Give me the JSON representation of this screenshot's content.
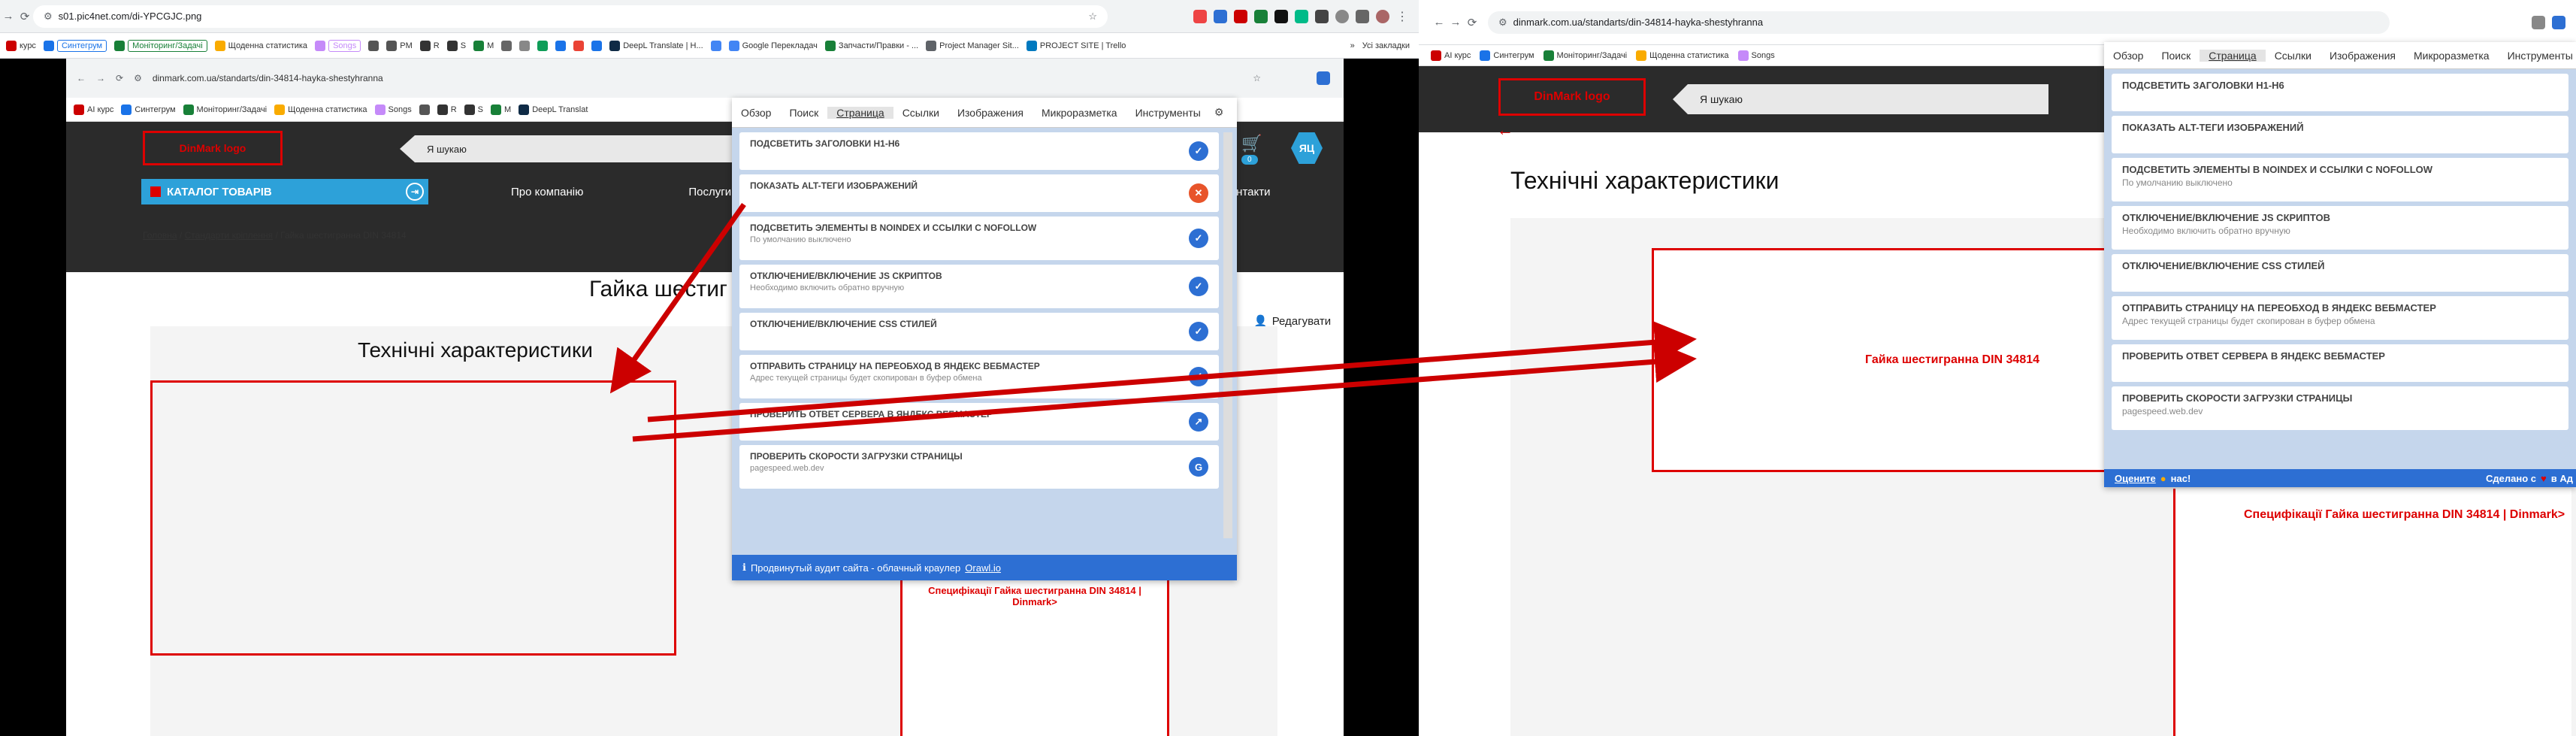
{
  "left_browser": {
    "url": "s01.pic4net.com/di-YPCGJC.png",
    "bookmarks": [
      {
        "label": "курс",
        "color": "#c00"
      },
      {
        "label": "Синтегрум",
        "color": "#1a73e8",
        "tag": true
      },
      {
        "label": "Моніторинг/Задачі",
        "color": "#188038",
        "tag": true
      },
      {
        "label": "Щоденна статистика",
        "color": "#f9ab00"
      },
      {
        "label": "Songs",
        "color": "#c58af9",
        "tag": true
      },
      {
        "label": "",
        "color": "#555"
      },
      {
        "label": "PM",
        "color": "#555"
      },
      {
        "label": "R",
        "color": "#333"
      },
      {
        "label": "S",
        "color": "#333"
      },
      {
        "label": "M",
        "color": "#188038"
      },
      {
        "label": "",
        "color": "#666"
      },
      {
        "label": "",
        "color": "#888"
      },
      {
        "label": "",
        "color": "#0f9d58"
      },
      {
        "label": "",
        "color": "#1a73e8"
      },
      {
        "label": "",
        "color": "#ea4335"
      },
      {
        "label": "",
        "color": "#1a73e8"
      },
      {
        "label": "DeepL Translate | Н...",
        "color": "#0f2b46"
      },
      {
        "label": "",
        "color": "#4285f4"
      },
      {
        "label": "Google Перекладач",
        "color": "#4285f4"
      },
      {
        "label": "Запчасти/Правки - ...",
        "color": "#188038"
      },
      {
        "label": "Project Manager Sit...",
        "color": "#5f6368"
      },
      {
        "label": "PROJECT SITE | Trello",
        "color": "#0079bf"
      }
    ],
    "bookmarks_more": "»",
    "all_bookmarks": "Усі закладки"
  },
  "inner_browser": {
    "url": "dinmark.com.ua/standarts/din-34814-hayka-shestyhranna",
    "bookmarks": [
      {
        "label": "AI курс",
        "color": "#c00"
      },
      {
        "label": "Синтегрум",
        "color": "#1a73e8"
      },
      {
        "label": "Моніторинг/Задачі",
        "color": "#188038"
      },
      {
        "label": "Щоденна статистика",
        "color": "#f9ab00"
      },
      {
        "label": "Songs",
        "color": "#c58af9"
      },
      {
        "label": "",
        "color": "#555"
      },
      {
        "label": "R",
        "color": "#333"
      },
      {
        "label": "S",
        "color": "#333"
      },
      {
        "label": "M",
        "color": "#188038"
      },
      {
        "label": "DeepL Translat",
        "color": "#0f2b46"
      }
    ]
  },
  "site": {
    "logo": "DinMark logo",
    "search_placeholder": "Я шукаю",
    "catalog": "КАТАЛОГ ТОВАРІВ",
    "menu": [
      "Про компанію",
      "Послуги",
      "Контакти"
    ],
    "cart_count": "0",
    "avatar": "ЯЦ",
    "breadcrumb": [
      "Головна",
      "Стандарти кріплення",
      "Гайка шестигранна DIN 34814"
    ],
    "breadcrumb_sep": "/",
    "page_title_partial": "Гайка шестиг",
    "edit_label": "Редагувати",
    "section_title": "Технічні характеристики",
    "image_alt": "Гайка шестигранна DIN 34814",
    "spec_link": "Специфікації Гайка шестигранна DIN 34814 | Dinmark>"
  },
  "extension": {
    "tabs": [
      "Обзор",
      "Поиск",
      "Страница",
      "Ссылки",
      "Изображения",
      "Микроразметка",
      "Инструменты"
    ],
    "active_tab": "Страница",
    "items": [
      {
        "title": "Подсветить заголовки H1-H6",
        "sub": "",
        "state": "check"
      },
      {
        "title": "Показать ALT-теги изображений",
        "sub": "",
        "state": "close"
      },
      {
        "title": "Подсветить элементы в noindex и ссылки с nofollow",
        "sub": "По умолчанию выключено",
        "state": "check"
      },
      {
        "title": "Отключение/включение JS скриптов",
        "sub": "Необходимо включить обратно вручную",
        "state": "check"
      },
      {
        "title": "Отключение/включение CSS стилей",
        "sub": "",
        "state": "check"
      },
      {
        "title": "Отправить страницу на переобход в Яндекс Вебмастер",
        "sub": "Адрес текущей страницы будет скопирован в буфер обмена",
        "state": "check"
      },
      {
        "title": "Проверить ответ сервера в Яндекс Вебмастер",
        "sub": "",
        "state": "link"
      },
      {
        "title": "Проверить скорости загрузки страницы",
        "sub": "pagespeed.web.dev",
        "state": "google"
      }
    ],
    "footer_text": "Продвинутый аудит сайта - облачный краулер",
    "footer_link": "Orawl.io",
    "rate_label": "Оцените",
    "rate_suffix": "нас!",
    "made_label": "Сделано с",
    "made_suffix": "в Ад"
  },
  "colors": {
    "accent_red": "#dd0000",
    "ext_blue": "#2d6fd3",
    "catalog_blue": "#2da1d9"
  }
}
